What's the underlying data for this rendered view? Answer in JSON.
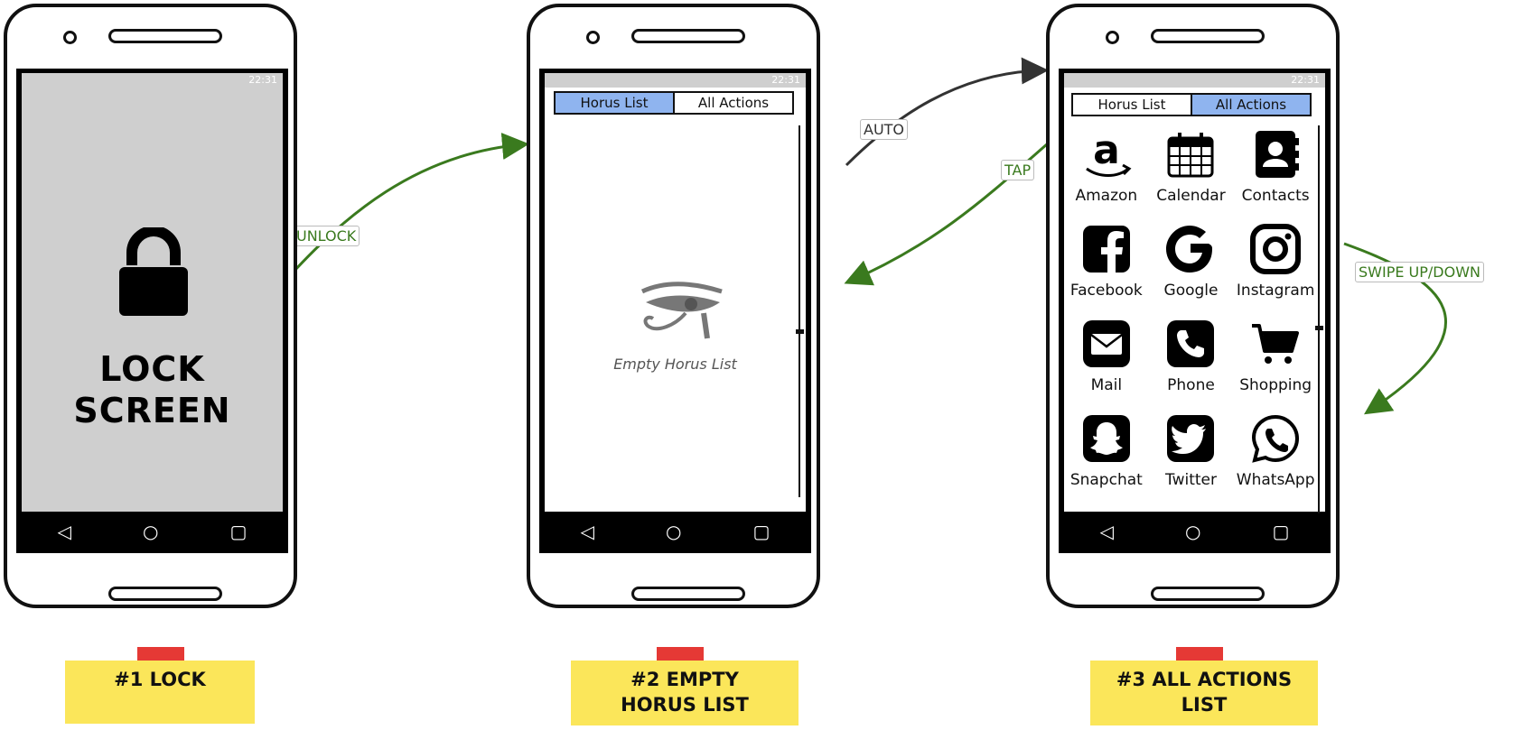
{
  "status_time": "22:31",
  "phone1": {
    "lock_line1": "LOCK",
    "lock_line2": "SCREEN",
    "note": "#1 LOCK"
  },
  "phone2": {
    "tabs": [
      "Horus List",
      "All Actions"
    ],
    "active_tab": 0,
    "empty_text": "Empty Horus List",
    "note_line1": "#2 EMPTY",
    "note_line2": "HORUS LIST"
  },
  "phone3": {
    "tabs": [
      "Horus List",
      "All Actions"
    ],
    "active_tab": 1,
    "apps": [
      {
        "label": "Amazon",
        "icon": "amazon-icon"
      },
      {
        "label": "Calendar",
        "icon": "calendar-icon"
      },
      {
        "label": "Contacts",
        "icon": "contacts-icon"
      },
      {
        "label": "Facebook",
        "icon": "facebook-icon"
      },
      {
        "label": "Google",
        "icon": "google-icon"
      },
      {
        "label": "Instagram",
        "icon": "instagram-icon"
      },
      {
        "label": "Mail",
        "icon": "mail-icon"
      },
      {
        "label": "Phone",
        "icon": "phone-icon"
      },
      {
        "label": "Shopping",
        "icon": "shopping-cart-icon"
      },
      {
        "label": "Snapchat",
        "icon": "snapchat-icon"
      },
      {
        "label": "Twitter",
        "icon": "twitter-icon"
      },
      {
        "label": "WhatsApp",
        "icon": "whatsapp-icon"
      }
    ],
    "note_line1": "#3 ALL ACTIONS",
    "note_line2": "LIST"
  },
  "transitions": {
    "unlock": "UNLOCK",
    "auto": "AUTO",
    "tap": "TAP",
    "swipe": "SWIPE UP/DOWN"
  },
  "colors": {
    "arrow_green": "#3a7a1e",
    "arrow_dark": "#333333",
    "tab_active": "#8fb4ef",
    "note": "#fbe65a",
    "tape": "#e53935",
    "lock_bg": "#cfcfcf"
  }
}
